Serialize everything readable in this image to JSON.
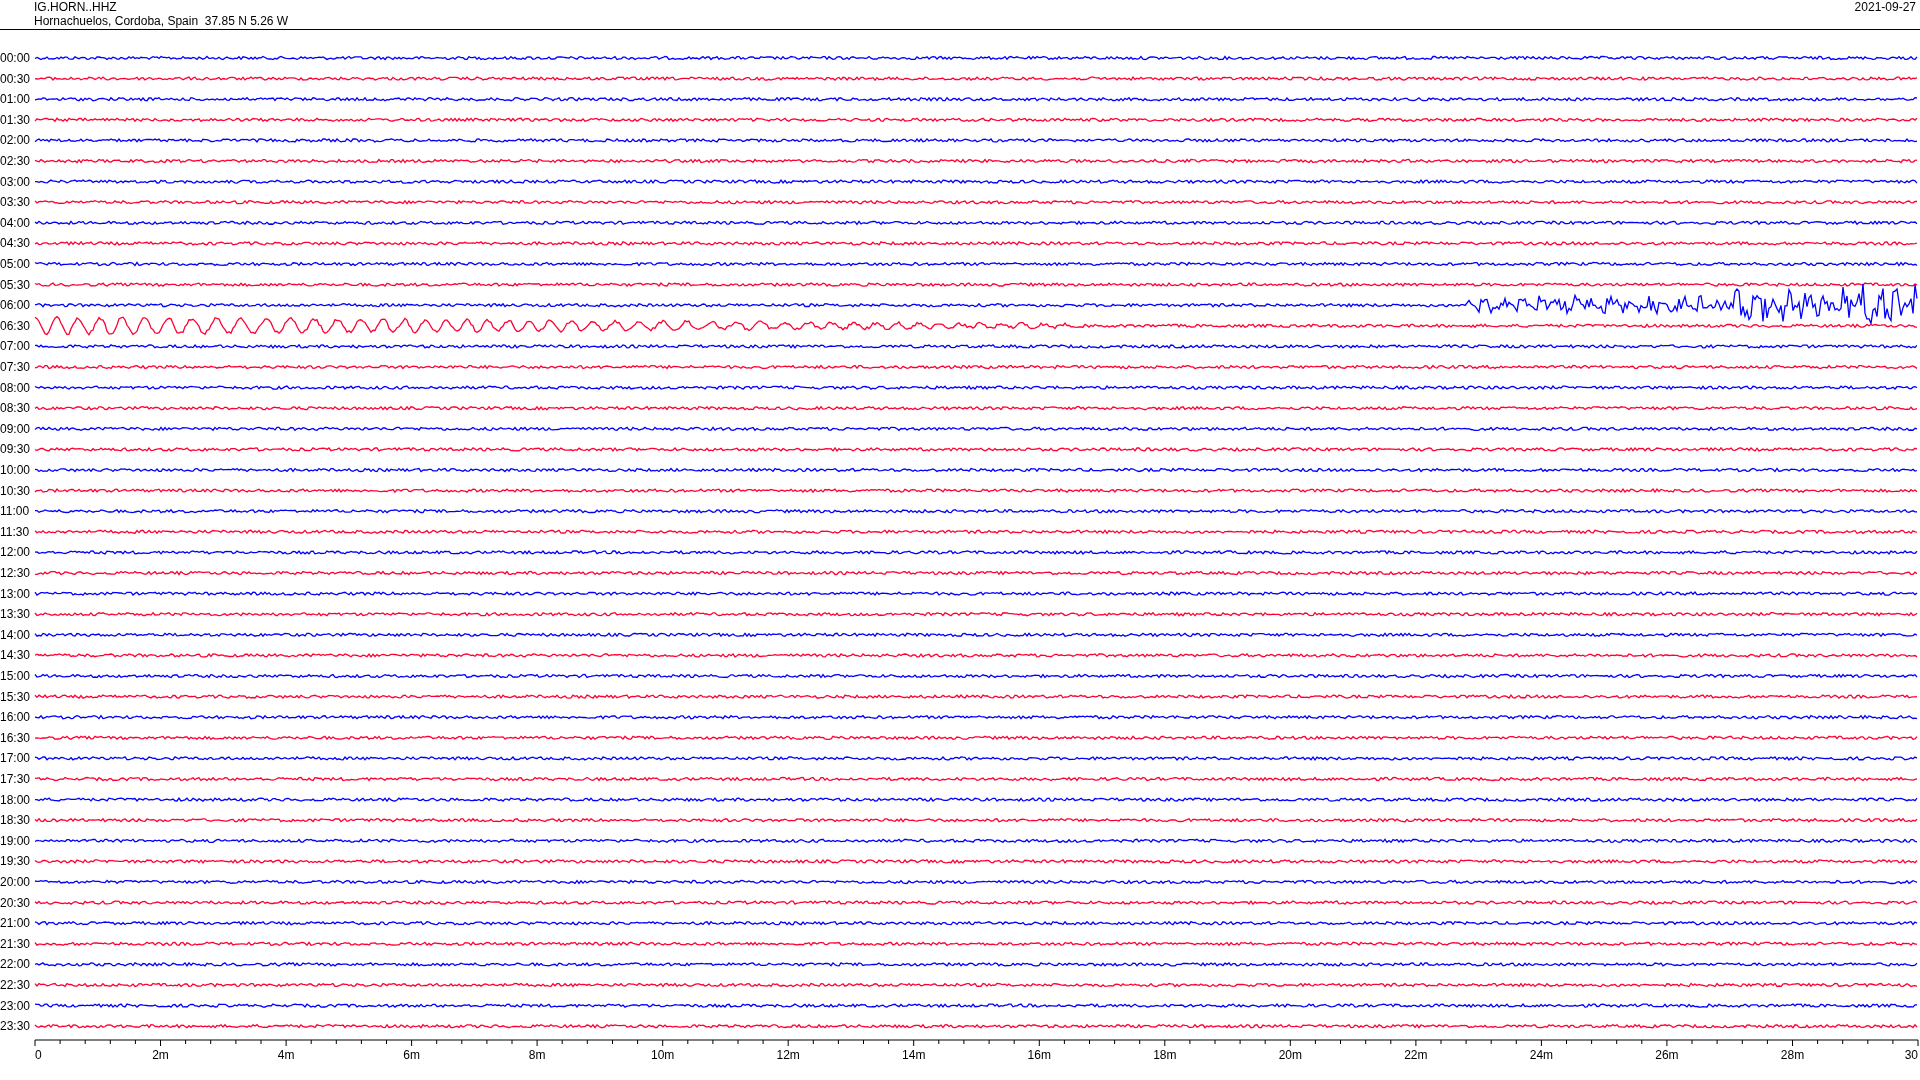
{
  "header": {
    "station": "IG.HORN..HHZ",
    "location": "Hornachuelos, Cordoba, Spain  37.85 N 5.26 W",
    "date": "2021-09-27"
  },
  "rows": [
    {
      "time": "00:00",
      "color": "#0000ff",
      "kind": "quiet"
    },
    {
      "time": "00:30",
      "color": "#ff0033",
      "kind": "quiet"
    },
    {
      "time": "01:00",
      "color": "#0000ff",
      "kind": "quiet"
    },
    {
      "time": "01:30",
      "color": "#ff0033",
      "kind": "quiet"
    },
    {
      "time": "02:00",
      "color": "#0000ff",
      "kind": "quiet"
    },
    {
      "time": "02:30",
      "color": "#ff0033",
      "kind": "quiet"
    },
    {
      "time": "03:00",
      "color": "#0000ff",
      "kind": "quiet"
    },
    {
      "time": "03:30",
      "color": "#ff0033",
      "kind": "quiet"
    },
    {
      "time": "04:00",
      "color": "#0000ff",
      "kind": "quiet"
    },
    {
      "time": "04:30",
      "color": "#ff0033",
      "kind": "quiet"
    },
    {
      "time": "05:00",
      "color": "#0000ff",
      "kind": "quiet"
    },
    {
      "time": "05:30",
      "color": "#ff0033",
      "kind": "quiet"
    },
    {
      "time": "06:00",
      "color": "#0000ff",
      "kind": "onset"
    },
    {
      "time": "06:30",
      "color": "#ff0033",
      "kind": "coda"
    },
    {
      "time": "07:00",
      "color": "#0000ff",
      "kind": "quiet"
    },
    {
      "time": "07:30",
      "color": "#ff0033",
      "kind": "quiet"
    },
    {
      "time": "08:00",
      "color": "#0000ff",
      "kind": "quiet"
    },
    {
      "time": "08:30",
      "color": "#ff0033",
      "kind": "quiet"
    },
    {
      "time": "09:00",
      "color": "#0000ff",
      "kind": "quiet"
    },
    {
      "time": "09:30",
      "color": "#ff0033",
      "kind": "quiet"
    },
    {
      "time": "10:00",
      "color": "#0000ff",
      "kind": "quiet"
    },
    {
      "time": "10:30",
      "color": "#ff0033",
      "kind": "quiet"
    },
    {
      "time": "11:00",
      "color": "#0000ff",
      "kind": "quiet"
    },
    {
      "time": "11:30",
      "color": "#ff0033",
      "kind": "quiet"
    },
    {
      "time": "12:00",
      "color": "#0000ff",
      "kind": "quiet"
    },
    {
      "time": "12:30",
      "color": "#ff0033",
      "kind": "quiet"
    },
    {
      "time": "13:00",
      "color": "#0000ff",
      "kind": "quiet"
    },
    {
      "time": "13:30",
      "color": "#ff0033",
      "kind": "quiet"
    },
    {
      "time": "14:00",
      "color": "#0000ff",
      "kind": "quiet"
    },
    {
      "time": "14:30",
      "color": "#ff0033",
      "kind": "quiet"
    },
    {
      "time": "15:00",
      "color": "#0000ff",
      "kind": "quiet"
    },
    {
      "time": "15:30",
      "color": "#ff0033",
      "kind": "quiet"
    },
    {
      "time": "16:00",
      "color": "#0000ff",
      "kind": "quiet"
    },
    {
      "time": "16:30",
      "color": "#ff0033",
      "kind": "quiet"
    },
    {
      "time": "17:00",
      "color": "#0000ff",
      "kind": "quiet"
    },
    {
      "time": "17:30",
      "color": "#ff0033",
      "kind": "quiet"
    },
    {
      "time": "18:00",
      "color": "#0000ff",
      "kind": "quiet"
    },
    {
      "time": "18:30",
      "color": "#ff0033",
      "kind": "quiet"
    },
    {
      "time": "19:00",
      "color": "#0000ff",
      "kind": "quiet"
    },
    {
      "time": "19:30",
      "color": "#ff0033",
      "kind": "quiet"
    },
    {
      "time": "20:00",
      "color": "#0000ff",
      "kind": "quiet"
    },
    {
      "time": "20:30",
      "color": "#ff0033",
      "kind": "quiet"
    },
    {
      "time": "21:00",
      "color": "#0000ff",
      "kind": "quiet"
    },
    {
      "time": "21:30",
      "color": "#ff0033",
      "kind": "quiet"
    },
    {
      "time": "22:00",
      "color": "#0000ff",
      "kind": "quiet"
    },
    {
      "time": "22:30",
      "color": "#ff0033",
      "kind": "quiet"
    },
    {
      "time": "23:00",
      "color": "#0000ff",
      "kind": "quiet"
    },
    {
      "time": "23:30",
      "color": "#ff0033",
      "kind": "quiet"
    }
  ],
  "x_axis": {
    "labels": [
      "0",
      "2m",
      "4m",
      "6m",
      "8m",
      "10m",
      "12m",
      "14m",
      "16m",
      "18m",
      "20m",
      "22m",
      "24m",
      "26m",
      "28m",
      "30"
    ]
  }
}
